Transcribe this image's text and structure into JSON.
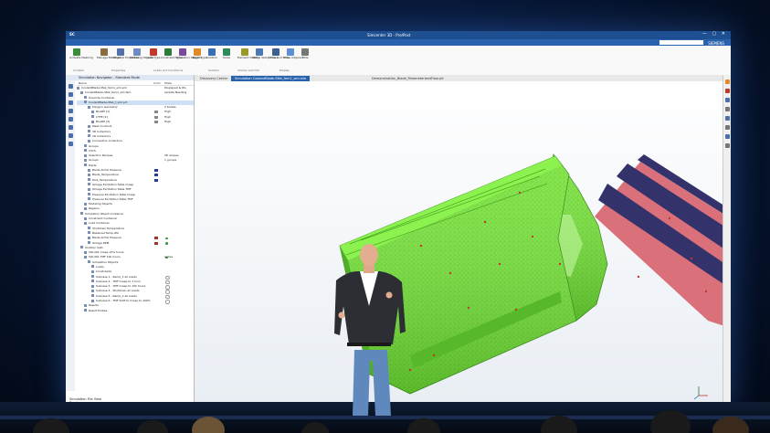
{
  "app": {
    "logo": "SC",
    "window_title": "Simcenter 3D - Pre/Post",
    "user": "SIEMENS",
    "window_controls": "— ▢ ✕"
  },
  "menu": {
    "items": [
      "File",
      "Home",
      "Results",
      "View",
      "Display",
      "Application",
      "TMP Utilities"
    ],
    "active_index": 1
  },
  "ribbon": {
    "buttons": [
      "Activate Meshing",
      "Manage Materials",
      "Physical Properties",
      "Modeling Objects",
      "Load Type",
      "Constraint Type",
      "Simulation Object Type",
      "Region",
      "Solution",
      "Solve",
      "Element Quality",
      "Model Setup Check",
      "Show and Hide",
      "Show Adjacent",
      "Hide"
    ],
    "groups": [
      "Context",
      "Properties",
      "Loads and Conditions",
      "Solution",
      "Checks and Info",
      "Display"
    ]
  },
  "navigator": {
    "title": "Simulation Navigator - Standard Mode",
    "columns": [
      "Name",
      "Color",
      "State"
    ],
    "rows": [
      {
        "label": "CoolantBlade-Sfek_fem1_sim.sim",
        "state": "Displayed & Wo"
      },
      {
        "label": "CoolantBlade-Sfek_fem1_sim.fem",
        "state": "Update Needing"
      },
      {
        "label": "Override Container",
        "state": ""
      },
      {
        "label": "CoolantBlade-Sfek_f_sim.prt",
        "state": ""
      },
      {
        "label": "Polygon Geometry",
        "state": "2 bodies"
      },
      {
        "label": "BLADE [1]",
        "state": "High"
      },
      {
        "label": "CTFE [2]",
        "state": "High"
      },
      {
        "label": "BLADE [3]",
        "state": "High"
      },
      {
        "label": "Mesh Controls",
        "state": ""
      },
      {
        "label": "3D Collectors",
        "state": ""
      },
      {
        "label": "1D Collectors",
        "state": ""
      },
      {
        "label": "Connection Collectors",
        "state": ""
      },
      {
        "label": "Groups",
        "state": ""
      },
      {
        "label": "CSYS",
        "state": ""
      },
      {
        "label": "Selection Recipes",
        "state": "28 recipes"
      },
      {
        "label": "Groups",
        "state": "1 groups"
      },
      {
        "label": "Fields",
        "state": ""
      },
      {
        "label": "Blade Airfoil Pressure",
        "state": ""
      },
      {
        "label": "Blade_Temperature",
        "state": ""
      },
      {
        "label": "Disk_Temperature",
        "state": ""
      },
      {
        "label": "Omega Excitation Table Creep",
        "state": ""
      },
      {
        "label": "Omega Excitation Table TMF",
        "state": ""
      },
      {
        "label": "Pressure Excitation Table Creep",
        "state": ""
      },
      {
        "label": "Pressure Excitation Table TMF",
        "state": ""
      },
      {
        "label": "Modeling Objects",
        "state": ""
      },
      {
        "label": "Regions",
        "state": ""
      },
      {
        "label": "Simulation Object Container",
        "state": ""
      },
      {
        "label": "Constraint Container",
        "state": ""
      },
      {
        "label": "Load Container",
        "state": ""
      },
      {
        "label": "Shutdown Temperature",
        "state": ""
      },
      {
        "label": "Baseload Temp LPA",
        "state": ""
      },
      {
        "label": "Blade Airfoil Pressure",
        "state": ""
      },
      {
        "label": "Omega RPM",
        "state": ""
      },
      {
        "label": "Solution Sets",
        "state": ""
      },
      {
        "label": "SOL401 Creep 15% hours",
        "state": ""
      },
      {
        "label": "SOL401 TMF 10k hours",
        "state": "Active"
      },
      {
        "label": "Simulation Objects",
        "state": ""
      },
      {
        "label": "Loads",
        "state": ""
      },
      {
        "label": "Constraints",
        "state": ""
      },
      {
        "label": "Subcase 1 - Ramp_1 all Loads",
        "state": ""
      },
      {
        "label": "Subcase 2 - TMF Creep to 1 hour",
        "state": ""
      },
      {
        "label": "Subcase 3 - TMF Creep to 10k hours",
        "state": ""
      },
      {
        "label": "Subcase 4 - Shutdown all Loads",
        "state": ""
      },
      {
        "label": "Subcase 5 - Ramp_2 all Loads",
        "state": ""
      },
      {
        "label": "Subcase 6 - TMF Shift to Creep to 100%",
        "state": ""
      },
      {
        "label": "Results",
        "state": ""
      },
      {
        "label": "Result Probes",
        "state": ""
      }
    ],
    "footer": [
      "Simulation File View",
      "Preview"
    ]
  },
  "tabs": [
    "Discovery Center",
    "Simulation CoolantBlade-Sfek_fem1_sim.sim",
    "Demonstration_Blade_ParameterizedFlow.prt"
  ],
  "colors": {
    "accent": "#2a63ad",
    "mesh_green": "#7ae63a",
    "root_pink": "#d9707a",
    "root_slot": "#33326b"
  }
}
